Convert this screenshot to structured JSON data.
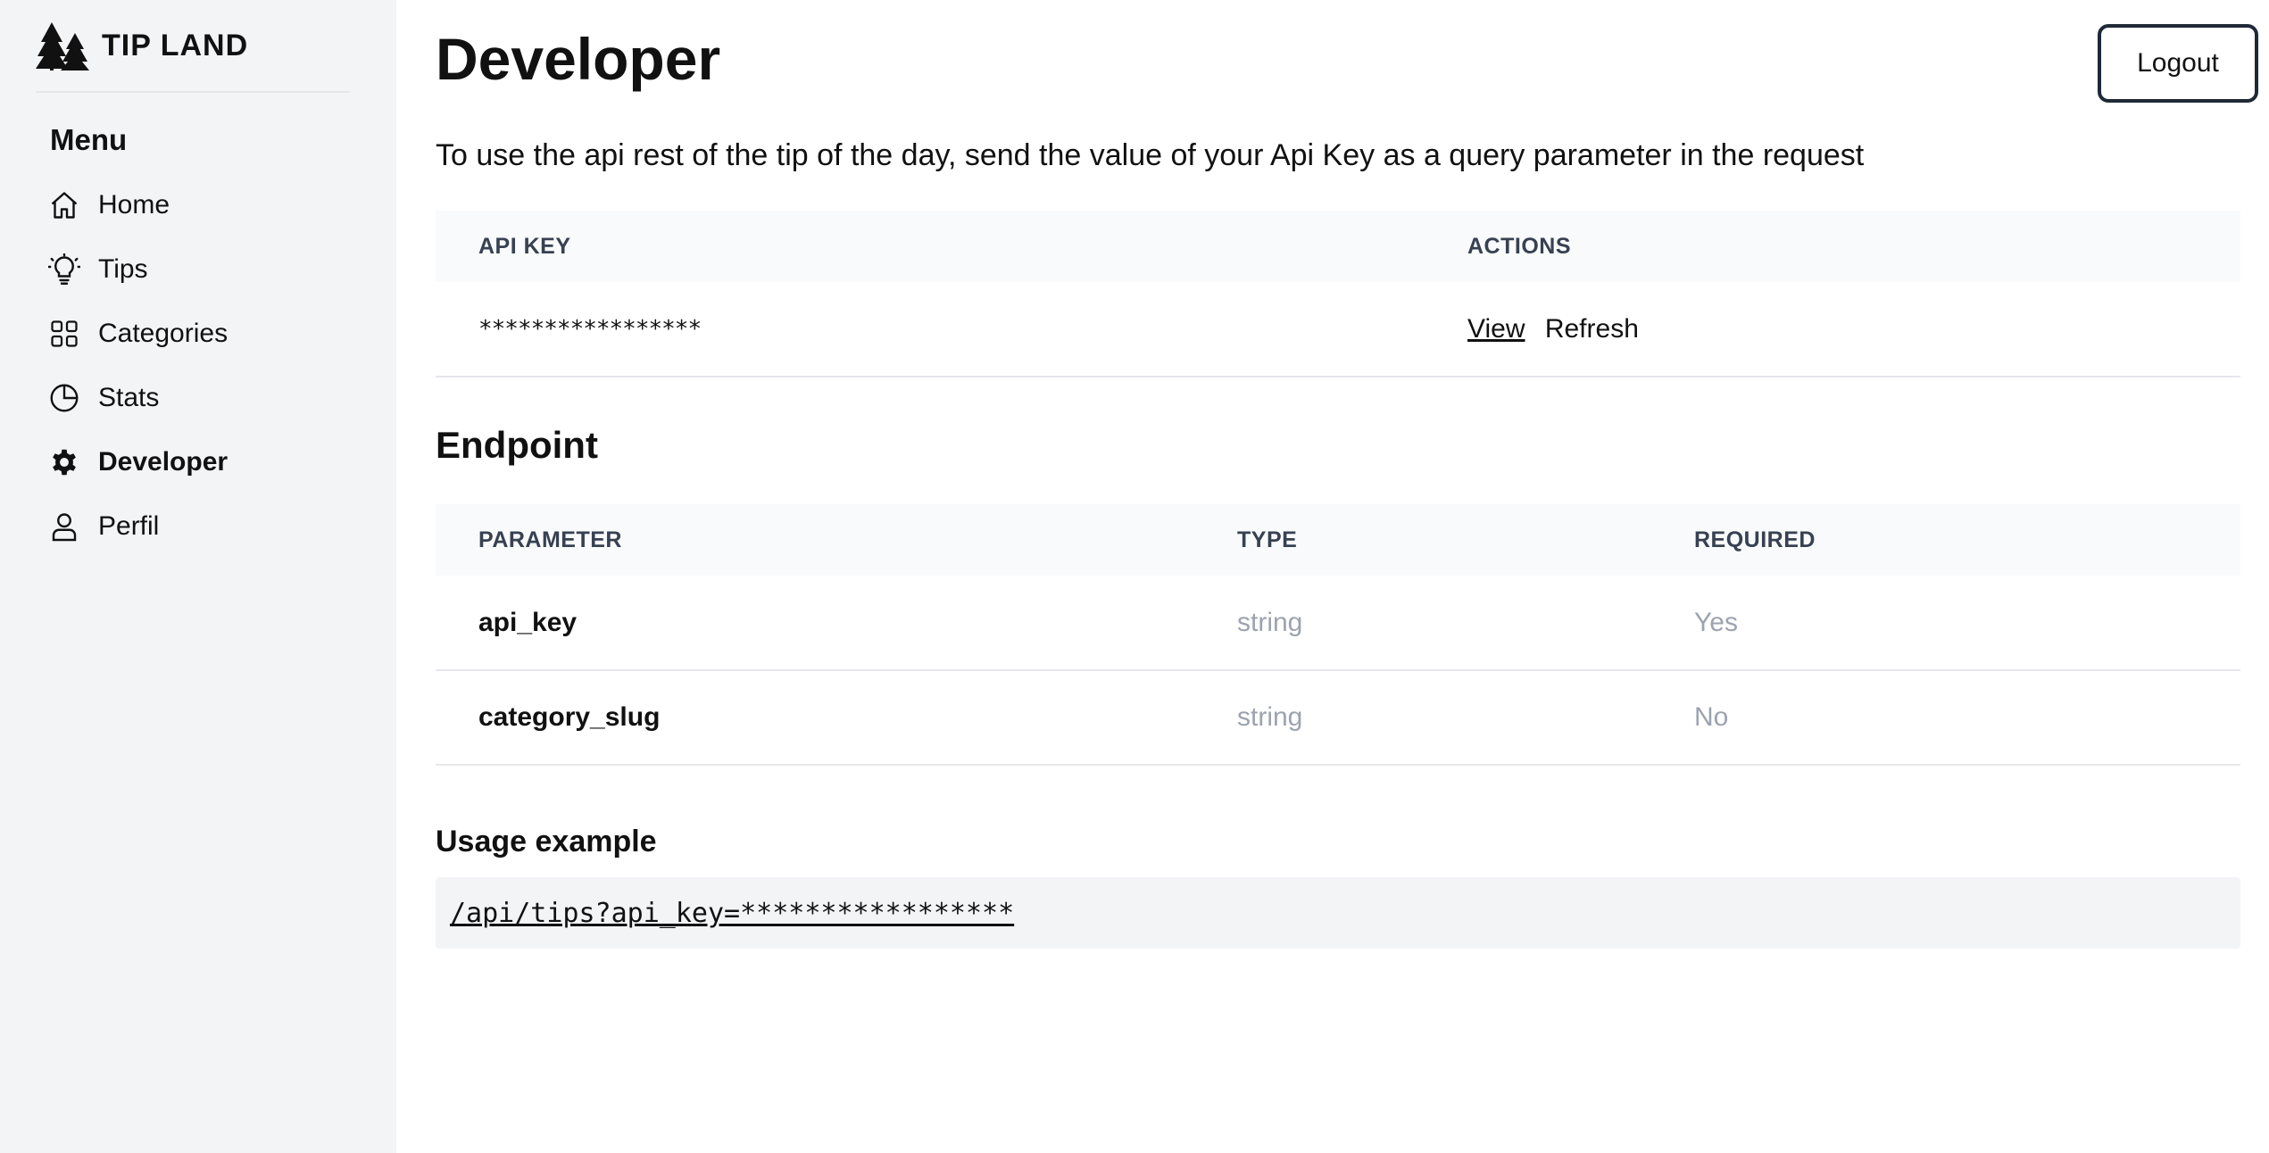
{
  "brand": {
    "name": "TIP LAND"
  },
  "sidebar": {
    "menu_title": "Menu",
    "items": [
      {
        "label": "Home",
        "icon": "home-icon"
      },
      {
        "label": "Tips",
        "icon": "lightbulb-icon"
      },
      {
        "label": "Categories",
        "icon": "grid-icon"
      },
      {
        "label": "Stats",
        "icon": "pie-chart-icon"
      },
      {
        "label": "Developer",
        "icon": "gear-icon",
        "active": true
      },
      {
        "label": "Perfil",
        "icon": "user-icon"
      }
    ]
  },
  "header": {
    "title": "Developer",
    "logout_label": "Logout"
  },
  "intro": "To use the api rest of the tip of the day, send the value of your Api Key as a query parameter in the request",
  "api_table": {
    "headers": [
      "API KEY",
      "ACTIONS"
    ],
    "key_value": "*****************",
    "actions": {
      "view": "View",
      "refresh": "Refresh"
    }
  },
  "endpoint": {
    "title": "Endpoint",
    "headers": [
      "PARAMETER",
      "TYPE",
      "REQUIRED"
    ],
    "rows": [
      {
        "parameter": "api_key",
        "type": "string",
        "required": "Yes"
      },
      {
        "parameter": "category_slug",
        "type": "string",
        "required": "No"
      }
    ]
  },
  "usage": {
    "title": "Usage example",
    "code": "/api/tips?api_key=*****************"
  },
  "colors": {
    "sidebar_bg": "#f3f4f6",
    "header_bg": "#f9fafb",
    "muted_text": "#9ca3af",
    "border": "#e5e7eb"
  }
}
